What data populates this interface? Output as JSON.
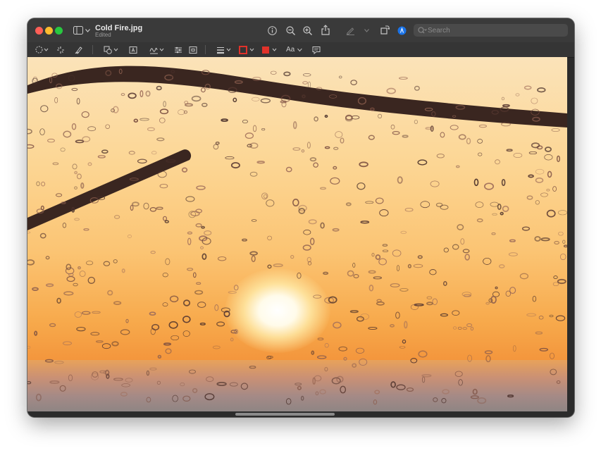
{
  "window": {
    "title": "Cold Fire.jpg",
    "subtitle": "Edited"
  },
  "search": {
    "placeholder": "Search"
  },
  "toolbar": {
    "text_style_label": "Aa"
  },
  "colors": {
    "accent": "#1a73e8",
    "border_color": "#e0322a",
    "fill_color": "#e0322a"
  },
  "icons": [
    "sidebar-icon",
    "chevron-down-icon",
    "info-icon",
    "zoom-out-icon",
    "zoom-in-icon",
    "share-icon",
    "markup-pen-icon",
    "rotate-icon",
    "highlight-icon",
    "search-icon",
    "selection-icon",
    "instant-alpha-icon",
    "sketch-icon",
    "shapes-icon",
    "text-box-icon",
    "sign-icon",
    "adjust-color-icon",
    "adjust-size-icon",
    "shape-style-icon",
    "border-color-icon",
    "fill-color-icon",
    "note-icon"
  ]
}
